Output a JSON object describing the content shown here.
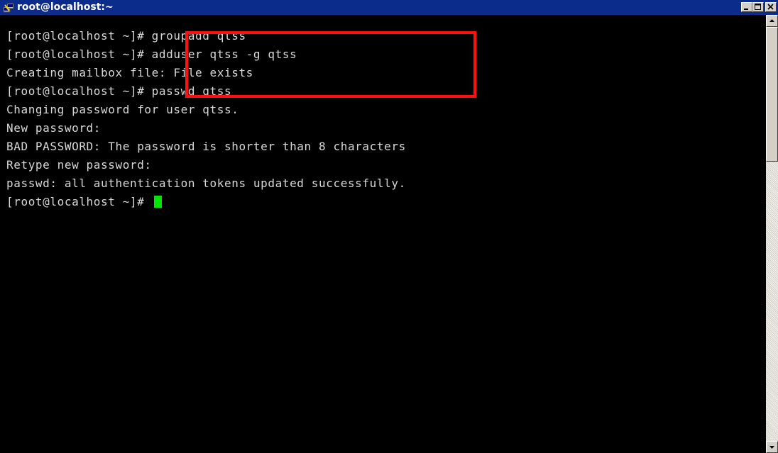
{
  "window": {
    "title": "root@localhost:~",
    "icon": "putty-icon"
  },
  "terminal": {
    "lines": [
      "[root@localhost ~]# groupadd qtss",
      "[root@localhost ~]# adduser qtss -g qtss",
      "Creating mailbox file: File exists",
      "[root@localhost ~]# passwd qtss",
      "Changing password for user qtss.",
      "New password:",
      "BAD PASSWORD: The password is shorter than 8 characters",
      "Retype new password:",
      "passwd: all authentication tokens updated successfully.",
      "[root@localhost ~]# "
    ],
    "cursor_color": "#00e600",
    "highlight_color": "#ff1010"
  },
  "colors": {
    "titlebar": "#0c2c8c",
    "text": "#d8d8d8",
    "background": "#000000"
  }
}
